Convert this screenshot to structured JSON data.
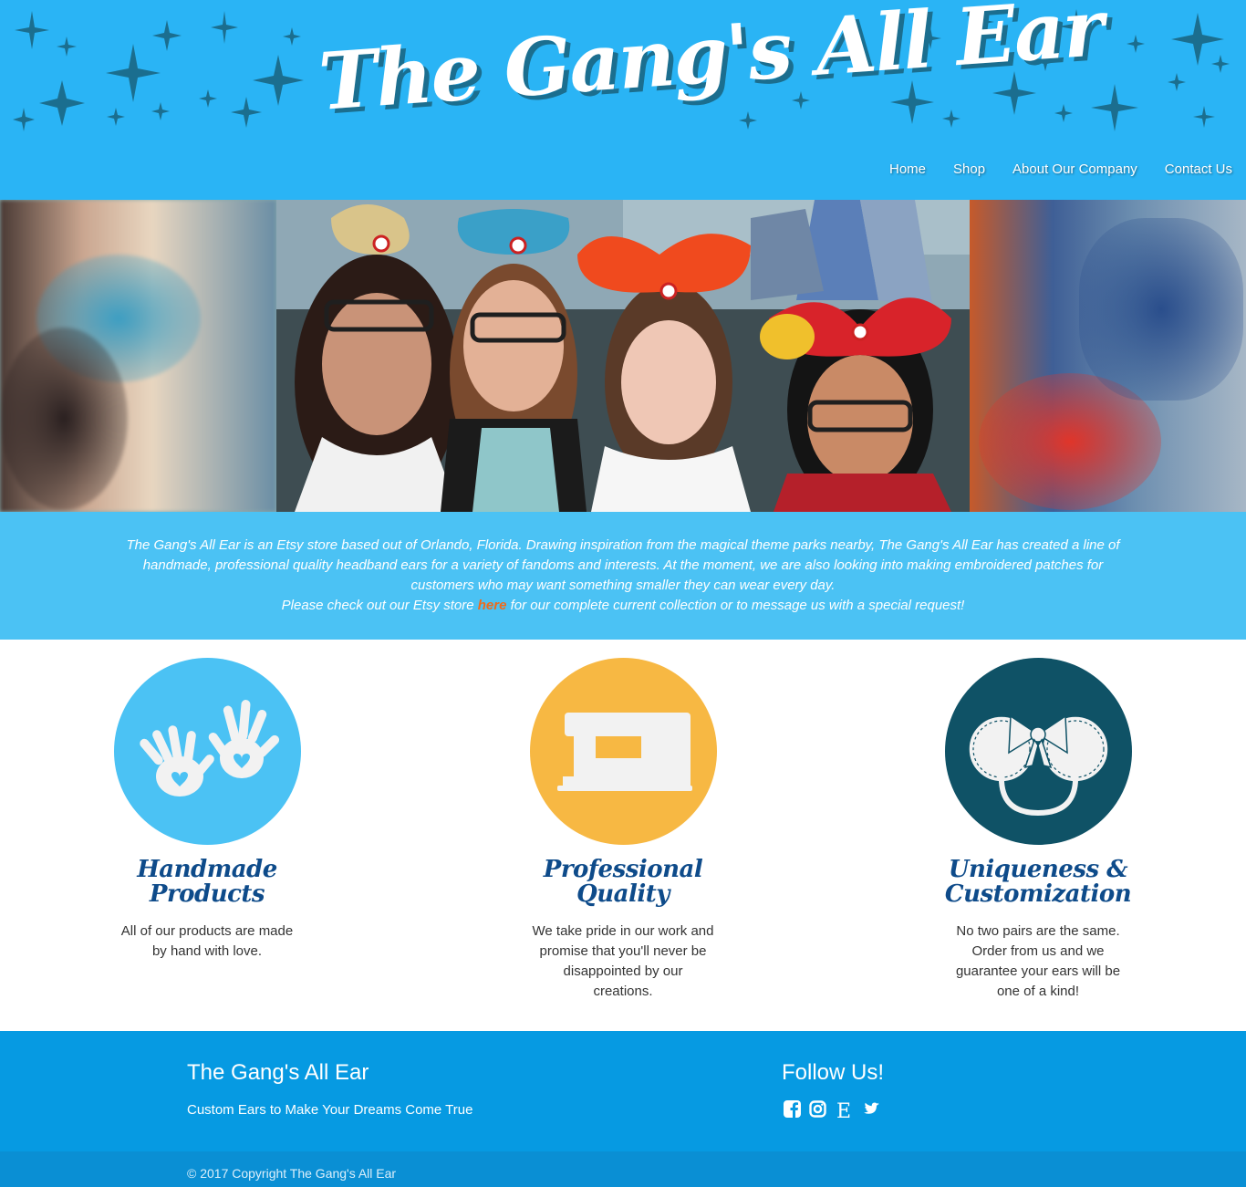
{
  "header": {
    "logo_text": "The Gang's All Ear",
    "background_color": "#2ab4f5",
    "star_color": "#1b6e8f"
  },
  "nav": {
    "items": [
      {
        "label": "Home"
      },
      {
        "label": "Shop"
      },
      {
        "label": "About Our Company"
      },
      {
        "label": "Contact Us"
      }
    ]
  },
  "intro": {
    "text_before": "The Gang's All Ear is an Etsy store based out of Orlando, Florida. Drawing inspiration from the magical theme parks nearby, The Gang's All Ear has created a line of handmade, professional quality headband ears for a variety of fandoms and interests. At the moment, we are also looking into making embroidered patches for customers who may want something smaller they can wear every day.",
    "line2_before": "Please check out our Etsy store ",
    "link_text": "here",
    "line2_after": " for our complete current collection or to message us with a special request!",
    "link_color": "#f06a1a"
  },
  "features": [
    {
      "icon": "handprints-icon",
      "color": "#4bc2f4",
      "title_line1": "Handmade",
      "title_line2": "Products",
      "text": "All of our products are made by hand with love."
    },
    {
      "icon": "sewing-machine-icon",
      "color": "#f7b843",
      "title_line1": "Professional",
      "title_line2": "Quality",
      "text": "We take pride in our work and promise that you'll never be disappointed by our creations."
    },
    {
      "icon": "mouse-ears-bow-icon",
      "color": "#0f5266",
      "title_line1": "Uniqueness &",
      "title_line2": "Customization",
      "text": "No two pairs are the same. Order from us and we guarantee your ears will be one of a kind!"
    }
  ],
  "footer": {
    "title": "The Gang's All Ear",
    "tagline": "Custom Ears to Make Your Dreams Come True",
    "follow_title": "Follow Us!",
    "social_icons": [
      "facebook-icon",
      "instagram-icon",
      "etsy-icon",
      "twitter-icon"
    ],
    "copyright": "© 2017 Copyright The Gang's All Ear"
  }
}
